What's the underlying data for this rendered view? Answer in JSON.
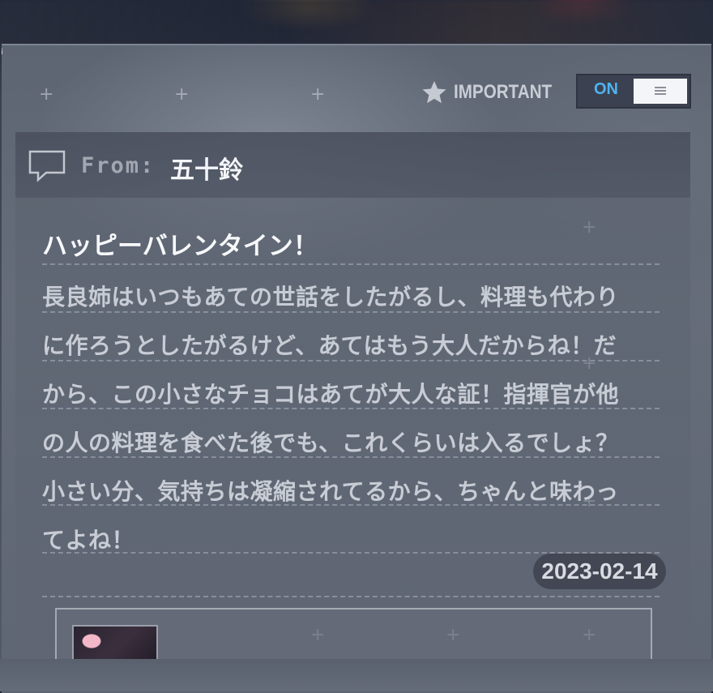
{
  "header": {
    "important_label": "IMPORTANT",
    "toggle_state": "ON"
  },
  "mail": {
    "from_label": "From:",
    "sender": "五十鈴",
    "title": "ハッピーバレンタイン！",
    "body_lines": [
      "長良姉はいつもあての世話をしたがるし、料理も代わり",
      "に作ろうとしたがるけど、あてはもう大人だからね！だ",
      "から、この小さなチョコはあてが大人な証！指揮官が他",
      "の人の料理を食べた後でも、これくらいは入るでしょ？",
      "小さい分、気持ちは凝縮されてるから、ちゃんと味わっ",
      "てよね！"
    ],
    "date": "2023-02-14"
  },
  "icons": {
    "star": "star-icon",
    "message": "message-icon",
    "menu": "menu-lines-icon",
    "avatar": "character-avatar"
  },
  "colors": {
    "toggle_on": "#4fb3f0",
    "panel": "#626a77",
    "text_primary": "#f7f8fa",
    "text_body": "#c8ccd4"
  }
}
